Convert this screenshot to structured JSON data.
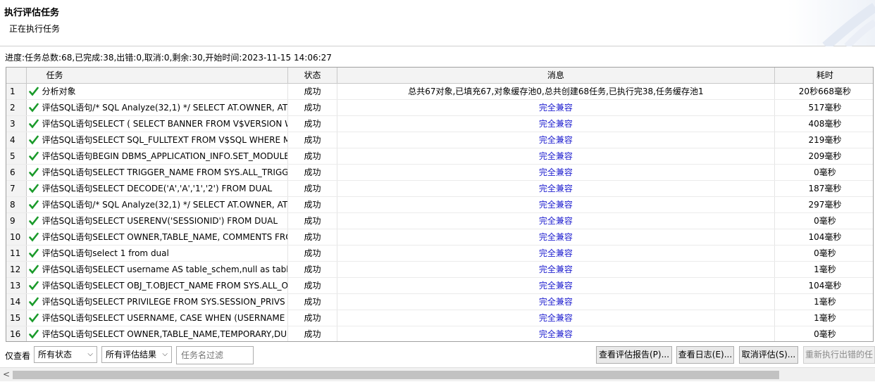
{
  "header": {
    "title": "执行评估任务",
    "subtitle": "正在执行任务"
  },
  "progress_text": "进度:任务总数:68,已完成:38,出错:0,取消:0,剩余:30,开始时间:2023-11-15 14:06:27",
  "table": {
    "columns": [
      "任务",
      "状态",
      "消息",
      "耗时"
    ],
    "rows": [
      {
        "num": "1",
        "task": "分析对象",
        "status": "成功",
        "message": "总共67对象,已填充67,对象缓存池0,总共创建68任务,已执行完38,任务缓存池1",
        "time": "20秒668毫秒"
      },
      {
        "num": "2",
        "task": "评估SQL语句/* SQL Analyze(32,1) */ SELECT AT.OWNER, AT.T",
        "status": "成功",
        "message": "完全兼容",
        "time": "517毫秒"
      },
      {
        "num": "3",
        "task": "评估SQL语句SELECT ( SELECT BANNER FROM V$VERSION W",
        "status": "成功",
        "message": "完全兼容",
        "time": "408毫秒"
      },
      {
        "num": "4",
        "task": "评估SQL语句SELECT SQL_FULLTEXT FROM V$SQL WHERE M",
        "status": "成功",
        "message": "完全兼容",
        "time": "219毫秒"
      },
      {
        "num": "5",
        "task": "评估SQL语句BEGIN DBMS_APPLICATION_INFO.SET_MODULE",
        "status": "成功",
        "message": "完全兼容",
        "time": "209毫秒"
      },
      {
        "num": "6",
        "task": "评估SQL语句SELECT TRIGGER_NAME FROM SYS.ALL_TRIGGE",
        "status": "成功",
        "message": "完全兼容",
        "time": "0毫秒"
      },
      {
        "num": "7",
        "task": "评估SQL语句SELECT DECODE('A','A','1','2') FROM DUAL",
        "status": "成功",
        "message": "完全兼容",
        "time": "187毫秒"
      },
      {
        "num": "8",
        "task": "评估SQL语句/* SQL Analyze(32,1) */ SELECT AT.OWNER, AT.T",
        "status": "成功",
        "message": "完全兼容",
        "time": "297毫秒"
      },
      {
        "num": "9",
        "task": "评估SQL语句SELECT USERENV('SESSIONID') FROM DUAL",
        "status": "成功",
        "message": "完全兼容",
        "time": "0毫秒"
      },
      {
        "num": "10",
        "task": "评估SQL语句SELECT OWNER,TABLE_NAME, COMMENTS FRO",
        "status": "成功",
        "message": "完全兼容",
        "time": "104毫秒"
      },
      {
        "num": "11",
        "task": "评估SQL语句select 1 from dual",
        "status": "成功",
        "message": "完全兼容",
        "time": "0毫秒"
      },
      {
        "num": "12",
        "task": "评估SQL语句SELECT username AS table_schem,null as table_",
        "status": "成功",
        "message": "完全兼容",
        "time": "1毫秒"
      },
      {
        "num": "13",
        "task": "评估SQL语句SELECT OBJ_T.OBJECT_NAME FROM SYS.ALL_O",
        "status": "成功",
        "message": "完全兼容",
        "time": "104毫秒"
      },
      {
        "num": "14",
        "task": "评估SQL语句SELECT PRIVILEGE FROM SYS.SESSION_PRIVS W",
        "status": "成功",
        "message": "完全兼容",
        "time": "1毫秒"
      },
      {
        "num": "15",
        "task": "评估SQL语句SELECT USERNAME, CASE WHEN (USERNAME",
        "status": "成功",
        "message": "完全兼容",
        "time": "1毫秒"
      },
      {
        "num": "16",
        "task": "评估SQL语句SELECT OWNER,TABLE_NAME,TEMPORARY,DUR",
        "status": "成功",
        "message": "完全兼容",
        "time": "0毫秒"
      }
    ]
  },
  "bottom": {
    "view_label": "仅查看",
    "status_select": "所有状态",
    "result_select": "所有评估结果",
    "filter_placeholder": "任务名过滤",
    "buttons": [
      "查看评估报告(P)...",
      "查看日志(E)...",
      "取消评估(S)...",
      "重新执行出错的任"
    ]
  },
  "colors": {
    "check": "#1a9a2a",
    "compatible": "#1f1fcf"
  }
}
